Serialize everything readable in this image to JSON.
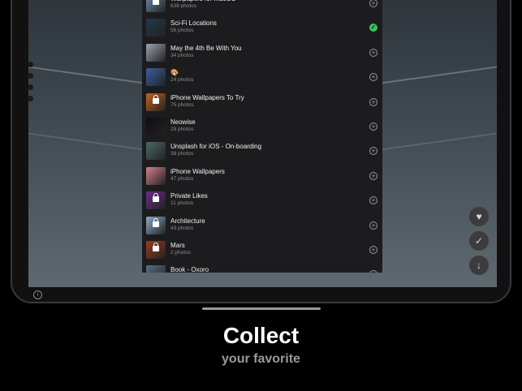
{
  "collections": [
    {
      "name": "Wallpapers for macOS",
      "count": "638 photos",
      "locked": true,
      "thumb": "#6d8fae",
      "state": "add"
    },
    {
      "name": "Sci-Fi Locations",
      "count": "56 photos",
      "locked": false,
      "thumb": "#1e3a4a",
      "state": "checked"
    },
    {
      "name": "May the 4th Be With You",
      "count": "34 photos",
      "locked": false,
      "thumb": "#9aa4ad",
      "state": "add"
    },
    {
      "name": "🎨",
      "count": "24 photos",
      "locked": false,
      "thumb": "#3a5f9f",
      "state": "add"
    },
    {
      "name": "iPhone Wallpapers To Try",
      "count": "75 photos",
      "locked": true,
      "thumb": "#c4631e",
      "state": "add"
    },
    {
      "name": "Neowise",
      "count": "29 photos",
      "locked": false,
      "thumb": "#0e0e12",
      "state": "add"
    },
    {
      "name": "Unsplash for iOS - On-boarding",
      "count": "38 photos",
      "locked": false,
      "thumb": "#4a6b6a",
      "state": "add"
    },
    {
      "name": "iPhone Wallpapers",
      "count": "47 photos",
      "locked": false,
      "thumb": "#d67f8a",
      "state": "add"
    },
    {
      "name": "Private Likes",
      "count": "11 photos",
      "locked": true,
      "thumb": "#6a2c8a",
      "state": "add"
    },
    {
      "name": "Architecture",
      "count": "43 photos",
      "locked": true,
      "thumb": "#8ea8c6",
      "state": "add"
    },
    {
      "name": "Mars",
      "count": "2 photos",
      "locked": true,
      "thumb": "#9a3a22",
      "state": "add"
    },
    {
      "name": "Book - Oxoro",
      "count": "",
      "locked": false,
      "thumb": "#5a6f86",
      "state": "add"
    }
  ],
  "actions": {
    "like_icon": "heart-icon",
    "collect_icon": "checkmark-icon",
    "download_icon": "arrow-down-icon"
  },
  "caption": {
    "headline": "Collect",
    "subheadline": "your favorite"
  },
  "colors": {
    "accent_checked": "#34c759",
    "panel_bg": "#1c1c1e"
  }
}
